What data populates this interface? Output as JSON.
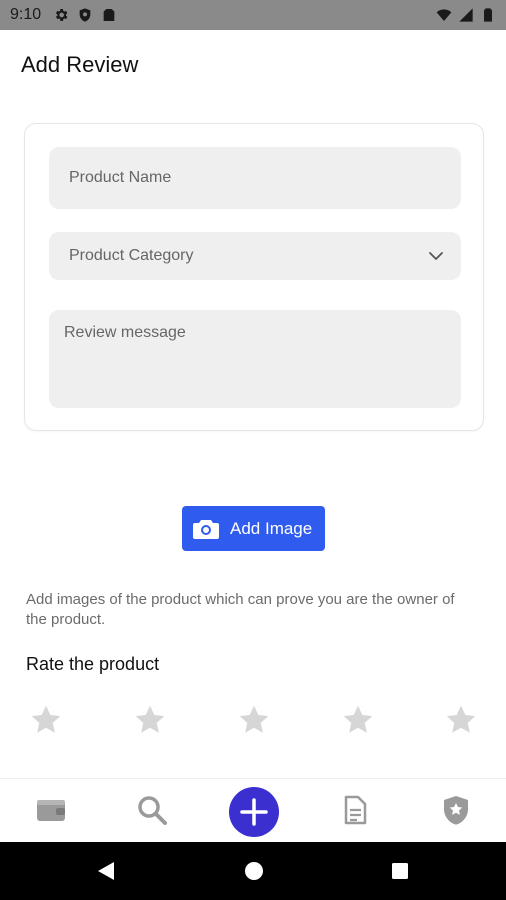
{
  "status_bar": {
    "time": "9:10",
    "left_icons": [
      "gear-icon",
      "shield-icon",
      "sim-card-icon"
    ],
    "right_icons": [
      "wifi-icon",
      "signal-icon",
      "battery-icon"
    ]
  },
  "page": {
    "title": "Add Review"
  },
  "form": {
    "product_name_placeholder": "Product Name",
    "product_category_placeholder": "Product Category",
    "review_message_placeholder": "Review message"
  },
  "add_image": {
    "label": "Add Image",
    "icon": "camera-icon"
  },
  "helper_text": "Add images of the product which can prove you are the owner of the product.",
  "rating": {
    "title": "Rate the product",
    "value": 0,
    "max": 5
  },
  "bottom_nav": {
    "items": [
      "wallet-icon",
      "search-icon",
      "add-icon",
      "document-icon",
      "shield-star-icon"
    ]
  },
  "colors": {
    "accent": "#2f5bef",
    "fab": "#3b2fd0",
    "field_bg": "#efefef",
    "star_inactive": "#d6d6d6"
  }
}
